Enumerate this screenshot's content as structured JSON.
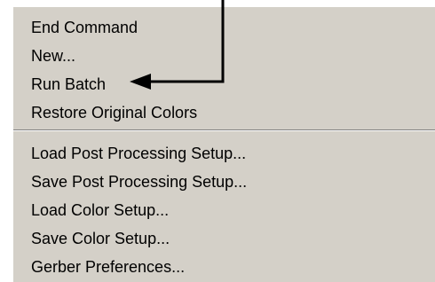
{
  "menu": {
    "group1": [
      {
        "label": "End Command"
      },
      {
        "label": "New..."
      },
      {
        "label": "Run Batch"
      },
      {
        "label": "Restore Original Colors"
      }
    ],
    "group2": [
      {
        "label": "Load Post Processing Setup..."
      },
      {
        "label": "Save Post Processing Setup..."
      },
      {
        "label": "Load Color Setup..."
      },
      {
        "label": "Save Color Setup..."
      },
      {
        "label": "Gerber Preferences..."
      }
    ]
  },
  "annotation": {
    "icon": "arrow-pointer-icon",
    "color": "#000000"
  }
}
